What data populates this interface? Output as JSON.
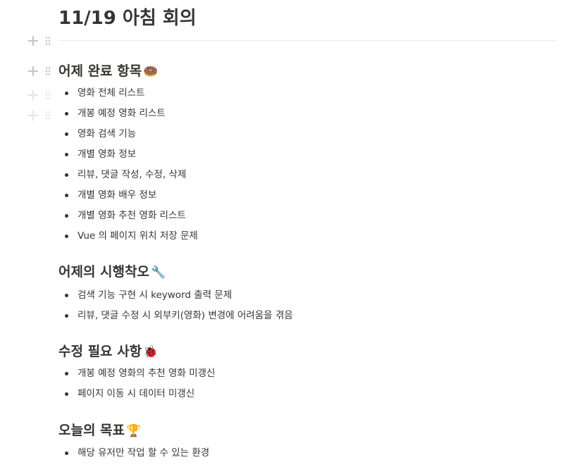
{
  "page": {
    "title": "11/19 아침 회의"
  },
  "sections": [
    {
      "heading": "어제 완료 항목",
      "emoji": "🍩",
      "items": [
        "영화 전체 리스트",
        "개봉 예정 영화 리스트",
        "영화 검색 기능",
        "개별 영화 정보",
        "리뷰, 댓글 작성, 수정, 삭제",
        "개별 영화 배우 정보",
        "개별 영화 추천 영화 리스트",
        "Vue 의 페이지 위치 저장 문제"
      ]
    },
    {
      "heading": "어제의 시행착오",
      "emoji": "🔧",
      "items": [
        "검색 기능 구현 시 keyword 출력 문제",
        "리뷰, 댓글 수정 시 외부키(영화) 변경에 어려움을 겪음"
      ]
    },
    {
      "heading": "수정 필요 사항",
      "emoji": "🐞",
      "items": [
        "개봉 예정 영화의 추천 영화 미갱신",
        "페이지 이동 시 데이터 미갱신"
      ]
    },
    {
      "heading": "오늘의 목표",
      "emoji": "🏆",
      "items": [
        "해당 유저만 작업 할 수 있는 환경"
      ]
    }
  ],
  "icons": {
    "add_block": "plus-icon",
    "drag_handle": "drag-handle-icon"
  },
  "colors": {
    "text": "#37352f",
    "divider": "#e9e9e7",
    "handle": "#c4c4c2"
  }
}
